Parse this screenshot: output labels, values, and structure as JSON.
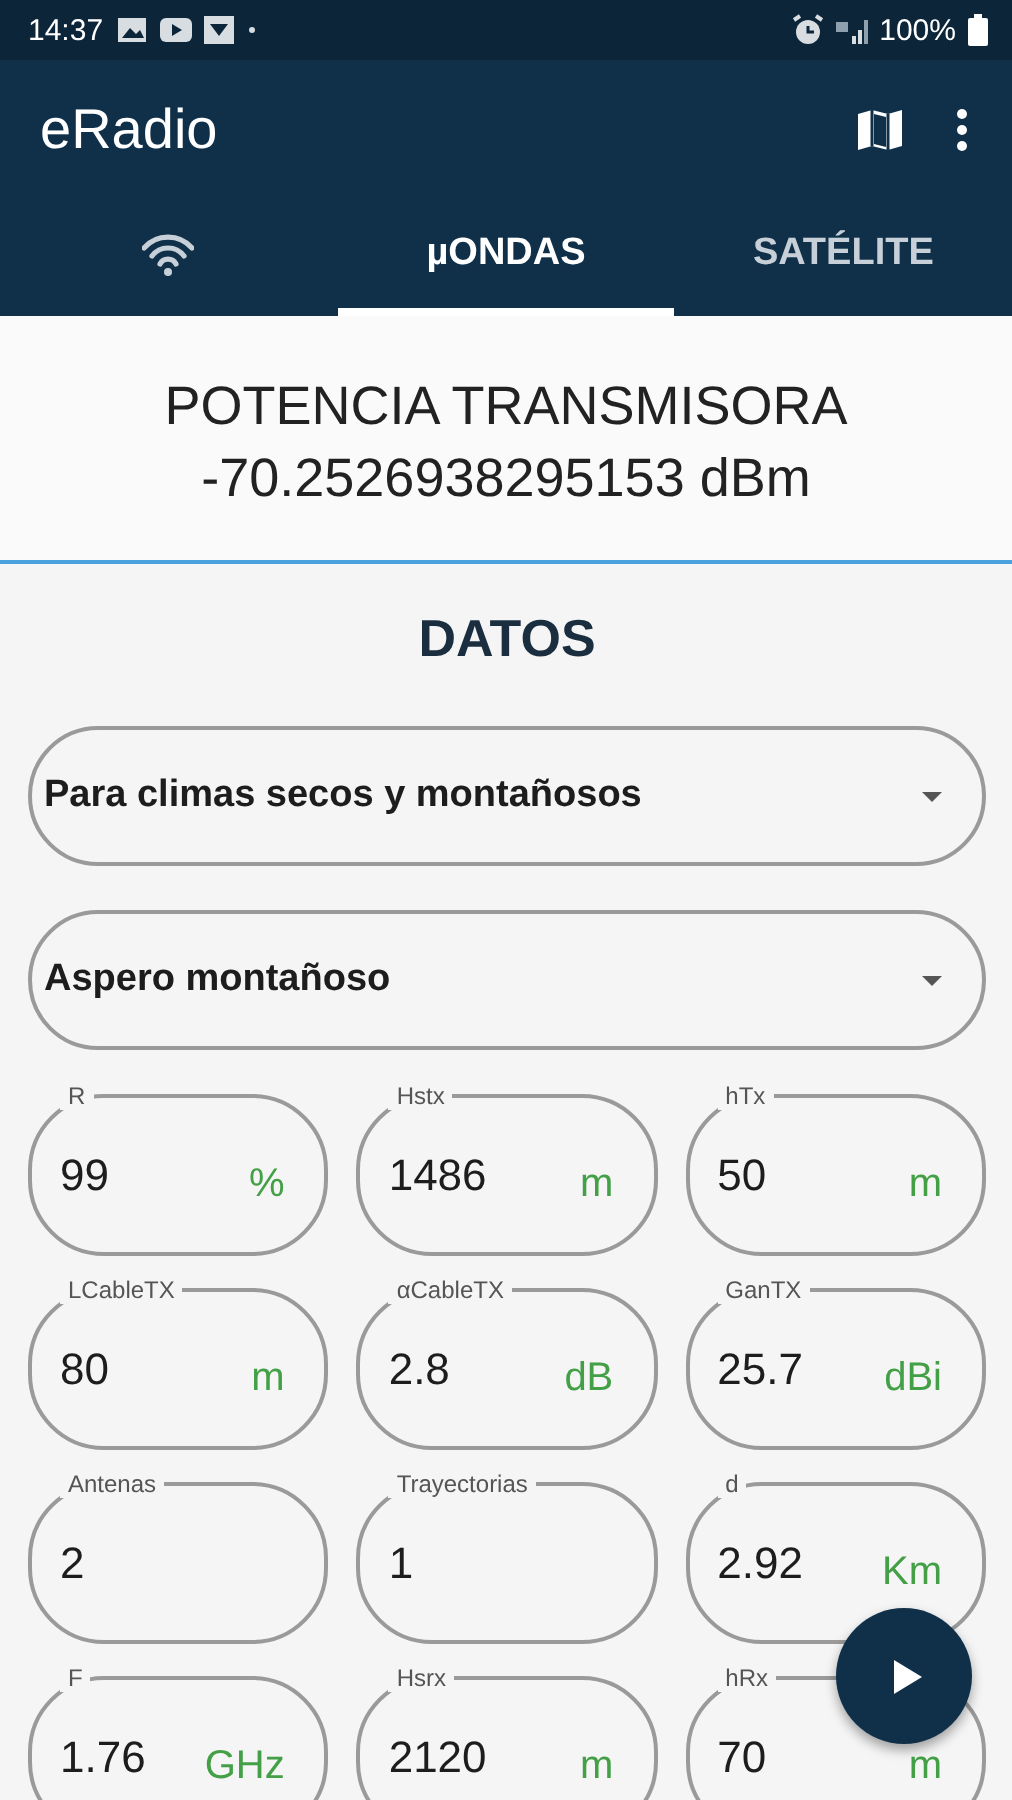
{
  "status_bar": {
    "time": "14:37",
    "battery": "100%"
  },
  "app_bar": {
    "title": "eRadio"
  },
  "tabs": [
    {
      "kind": "icon",
      "selected": false
    },
    {
      "kind": "text",
      "label": "µONDAS",
      "selected": true
    },
    {
      "kind": "text",
      "label": "SATÉLITE",
      "selected": false
    }
  ],
  "result": {
    "title": "POTENCIA TRANSMISORA",
    "value": "-70.2526938295153 dBm"
  },
  "section_title": "DATOS",
  "dropdowns": [
    {
      "value": "Para climas secos y montañosos"
    },
    {
      "value": "Aspero montañoso"
    }
  ],
  "fields": [
    {
      "label": "R",
      "value": "99",
      "unit": "%"
    },
    {
      "label": "Hstx",
      "value": "1486",
      "unit": "m"
    },
    {
      "label": "hTx",
      "value": "50",
      "unit": "m"
    },
    {
      "label": "LCableTX",
      "value": "80",
      "unit": "m"
    },
    {
      "label": "αCableTX",
      "value": "2.8",
      "unit": "dB"
    },
    {
      "label": "GanTX",
      "value": "25.7",
      "unit": "dBi"
    },
    {
      "label": "Antenas",
      "value": "2"
    },
    {
      "label": "Trayectorias",
      "value": "1"
    },
    {
      "label": "d",
      "value": "2.92",
      "unit": "Km"
    },
    {
      "label": "F",
      "value": "1.76",
      "unit": "GHz"
    },
    {
      "label": "Hsrx",
      "value": "2120",
      "unit": "m"
    },
    {
      "label": "hRx",
      "value": "70",
      "unit": "m"
    }
  ]
}
